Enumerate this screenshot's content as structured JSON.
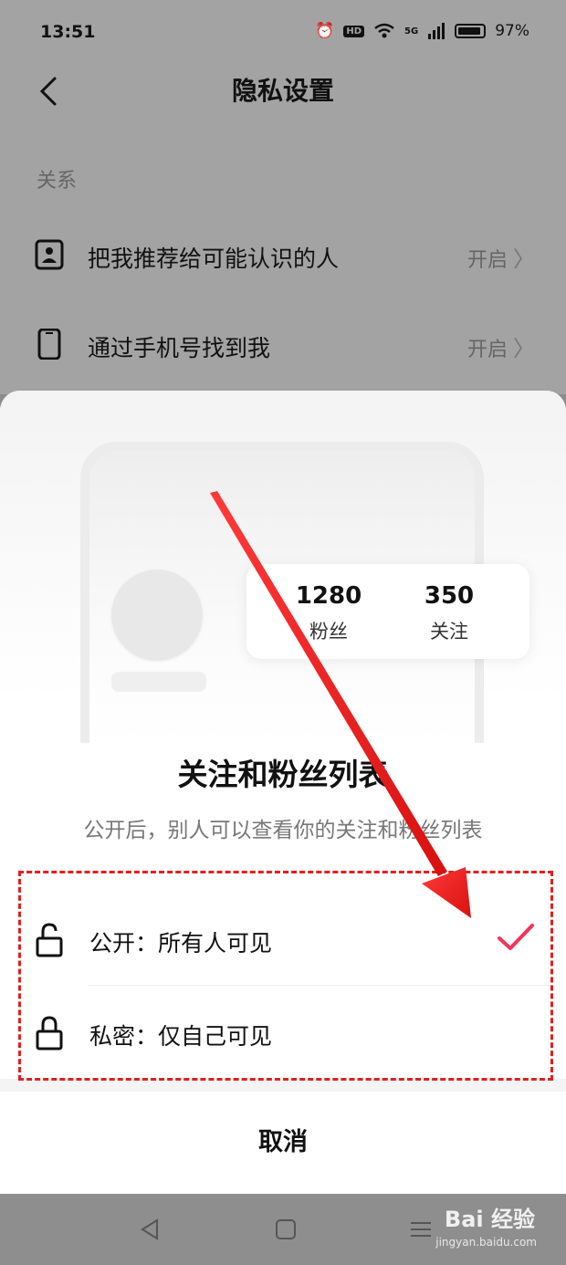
{
  "status_bar": {
    "time": "13:51",
    "hd": "HD",
    "network": "5G",
    "battery": "97%"
  },
  "header": {
    "title": "隐私设置"
  },
  "section": {
    "title": "关系"
  },
  "rows": [
    {
      "label": "把我推荐给可能认识的人",
      "value": "开启"
    },
    {
      "label": "通过手机号找到我",
      "value": "开启"
    }
  ],
  "sheet": {
    "stats": [
      {
        "number": "1280",
        "label": "粉丝"
      },
      {
        "number": "350",
        "label": "关注"
      }
    ],
    "title": "关注和粉丝列表",
    "description": "公开后，别人可以查看你的关注和粉丝列表",
    "options": [
      {
        "label": "公开：所有人可见",
        "selected": true
      },
      {
        "label": "私密：仅自己可见",
        "selected": false
      }
    ],
    "cancel": "取消"
  },
  "watermark": {
    "brand": "Bai 经验",
    "url": "jingyan.baidu.com"
  },
  "colors": {
    "accent": "#f0355a",
    "annotation": "#e02020"
  }
}
